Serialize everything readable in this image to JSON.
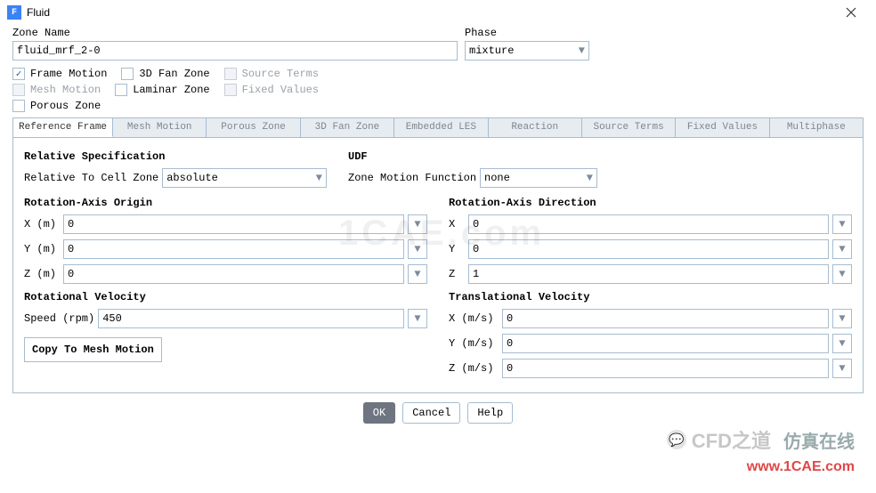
{
  "window": {
    "title": "Fluid"
  },
  "fields": {
    "zone_name_label": "Zone Name",
    "zone_name_value": "fluid_mrf_2-0",
    "phase_label": "Phase",
    "phase_value": "mixture"
  },
  "checks": {
    "frame_motion": "Frame Motion",
    "threed_fan_zone": "3D Fan Zone",
    "source_terms": "Source Terms",
    "mesh_motion": "Mesh Motion",
    "laminar_zone": "Laminar Zone",
    "fixed_values": "Fixed Values",
    "porous_zone": "Porous Zone"
  },
  "tabs": [
    "Reference Frame",
    "Mesh Motion",
    "Porous Zone",
    "3D Fan Zone",
    "Embedded LES",
    "Reaction",
    "Source Terms",
    "Fixed Values",
    "Multiphase"
  ],
  "panel": {
    "rel_spec_title": "Relative Specification",
    "rel_to_cell_label": "Relative To Cell Zone",
    "rel_to_cell_value": "absolute",
    "udf_title": "UDF",
    "zone_motion_label": "Zone Motion Function",
    "zone_motion_value": "none",
    "rot_origin_title": "Rotation-Axis Origin",
    "rot_origin": {
      "x_label": "X (m)",
      "x": "0",
      "y_label": "Y (m)",
      "y": "0",
      "z_label": "Z (m)",
      "z": "0"
    },
    "rot_dir_title": "Rotation-Axis Direction",
    "rot_dir": {
      "x_label": "X",
      "x": "0",
      "y_label": "Y",
      "y": "0",
      "z_label": "Z",
      "z": "1"
    },
    "rot_vel_title": "Rotational Velocity",
    "speed_label": "Speed (rpm)",
    "speed_value": "450",
    "trans_vel_title": "Translational Velocity",
    "trans_vel": {
      "x_label": "X (m/s)",
      "x": "0",
      "y_label": "Y (m/s)",
      "y": "0",
      "z_label": "Z (m/s)",
      "z": "0"
    },
    "copy_btn": "Copy To Mesh Motion"
  },
  "buttons": {
    "ok": "OK",
    "cancel": "Cancel",
    "help": "Help"
  },
  "watermark": {
    "center": "1CAE.com",
    "brand": "CFD之道",
    "cn": "仿真在线",
    "url": "www.1CAE.com"
  }
}
